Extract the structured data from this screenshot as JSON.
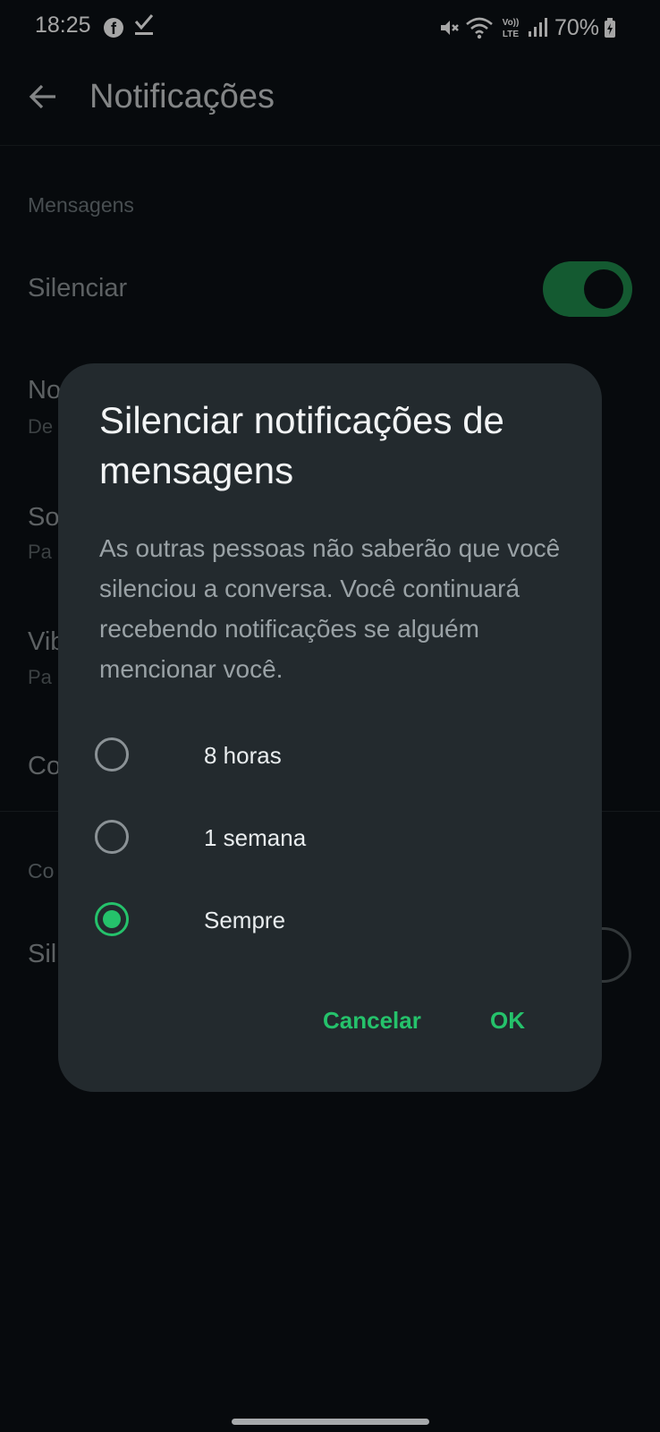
{
  "status_bar": {
    "time": "18:25",
    "icons": [
      "facebook-icon",
      "download-done-icon",
      "mute-icon",
      "wifi-icon",
      "volte-icon",
      "signal-icon"
    ],
    "battery": "70%"
  },
  "app_bar": {
    "title": "Notificações"
  },
  "list": {
    "section_messages": "Mensagens",
    "silence_label": "Silenciar",
    "silence_on": true,
    "row2_fragment": "No",
    "row2_sub_fragment": "De",
    "row3_fragment": "So",
    "row3_sub_fragment": "Pa",
    "row4_fragment": "Vib",
    "row4_sub_fragment": "Pa",
    "row5_fragment": "Co",
    "section2_fragment": "Co",
    "row6_fragment": "Sil"
  },
  "dialog": {
    "title": "Silenciar notificações de mensagens",
    "body": "As outras pessoas não saberão que você silenciou a conversa. Você continuará recebendo notificações se alguém mencionar você.",
    "options": [
      {
        "label": "8 horas",
        "selected": false
      },
      {
        "label": "1 semana",
        "selected": false
      },
      {
        "label": "Sempre",
        "selected": true
      }
    ],
    "cancel": "Cancelar",
    "ok": "OK"
  },
  "colors": {
    "accent": "#25c26b",
    "toggle_on": "#1f8a4c",
    "background": "#0b1014",
    "dialog": "#232a2e"
  }
}
